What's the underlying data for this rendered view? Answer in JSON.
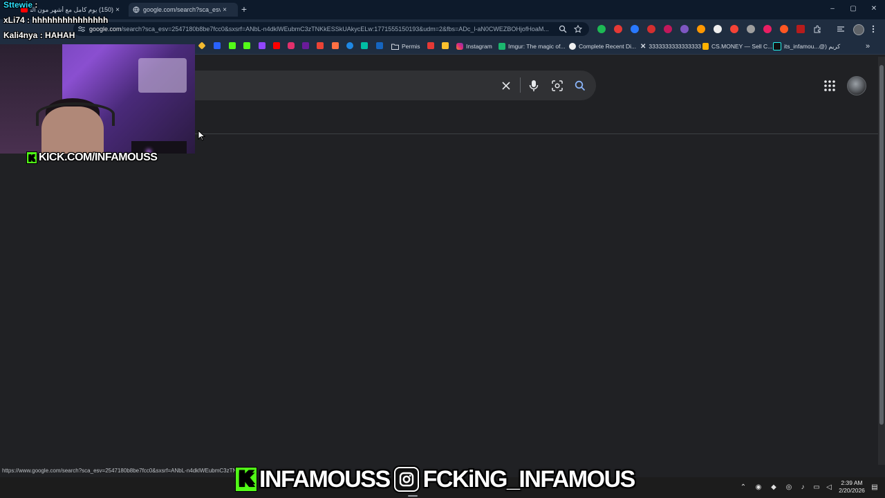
{
  "browser": {
    "tabs": [
      {
        "title": "(150) يوم كامل مع أشهر مون الناس",
        "active": false
      },
      {
        "title": "google.com/search?sca_esv=25",
        "active": true
      }
    ],
    "new_tab_symbol": "+",
    "tab_close_symbol": "×",
    "window_controls": [
      "–",
      "▢",
      "✕"
    ],
    "url": {
      "host": "google.com",
      "path": "/search?sca_esv=2547180b8be7fcc0&sxsrf=ANbL-n4dklWEubmC3zTNKkESSkUAkycELw:1771555150193&udm=2&fbs=ADc_l-aN0CWEZBOHjofHoaM..."
    },
    "bookmarks": [
      {
        "label": "Permis",
        "icon": "folder-icon"
      },
      {
        "label": "Instagram",
        "icon": "instagram-icon"
      },
      {
        "label": "Imgur: The magic of...",
        "icon": "imgur-icon"
      },
      {
        "label": "Complete Recent Di...",
        "icon": "github-icon"
      },
      {
        "label": "3333333333333333",
        "icon": "x-icon"
      },
      {
        "label": "CS.MONEY — Sell C...",
        "icon": "csmoney-icon"
      },
      {
        "label": "its_infamou...@) كريم",
        "icon": "tiktok-icon"
      }
    ],
    "bookmarks_more": "»",
    "status_url": "https://www.google.com/search?sca_esv=2547180b8be7fcc0&sxsrf=ANbL-n4dklWEubmC3zTN"
  },
  "google": {
    "search_value": "",
    "clear_icon": "close-icon",
    "voice_icon": "mic-icon",
    "lens_icon": "lens-icon",
    "search_icon": "search-icon"
  },
  "stream": {
    "chat": [
      {
        "user": "Sttewie",
        "message": ""
      },
      {
        "user": "xLi74",
        "message": "hhhhhhhhhhhhhhh"
      },
      {
        "user": "Kali4nya",
        "message": "HAHAH"
      }
    ],
    "webcam_label": "KICK.COM/INFAMOUSS",
    "webcam_badge": "K",
    "banner_left": "INFAMOUSS",
    "banner_right": "FCKiNG_INFAMOUS",
    "banner_kick_badge": "K"
  },
  "taskbar": {
    "time": "2:39 AM",
    "date": "2/20/2026"
  },
  "colors": {
    "tab_strip": "#0d1a2b",
    "toolbar": "#1f2d40",
    "page_bg": "#202124",
    "search_box": "#303134",
    "kick_green": "#53fc18"
  }
}
